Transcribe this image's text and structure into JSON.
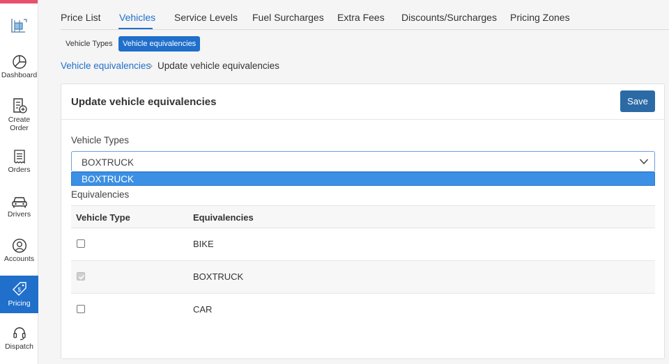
{
  "sidebar": {
    "items": [
      {
        "label": "Dashboard",
        "icon": "pie-chart-icon"
      },
      {
        "label": "Create Order",
        "icon": "new-document-icon"
      },
      {
        "label": "Orders",
        "icon": "receipt-icon"
      },
      {
        "label": "Drivers",
        "icon": "car-icon"
      },
      {
        "label": "Accounts",
        "icon": "user-circle-icon"
      },
      {
        "label": "Pricing",
        "icon": "price-tag-icon",
        "active": true
      },
      {
        "label": "Dispatch",
        "icon": "headset-icon"
      }
    ]
  },
  "tabs": [
    "Price List",
    "Vehicles",
    "Service Levels",
    "Fuel Surcharges",
    "Extra Fees",
    "Discounts/Surcharges",
    "Pricing Zones"
  ],
  "active_tab": "Vehicles",
  "subtabs": [
    "Vehicle Types",
    "Vehicle equivalencies"
  ],
  "active_subtab": "Vehicle equivalencies",
  "breadcrumb": {
    "parent": "Vehicle equivalencies",
    "separator": ">",
    "current": "Update vehicle equivalencies"
  },
  "card": {
    "title": "Update vehicle equivalencies",
    "save_label": "Save",
    "vehicle_types_label": "Vehicle Types",
    "selected_vehicle_type": "BOXTRUCK",
    "dropdown_options": [
      "BOXTRUCK"
    ],
    "equivalencies_label": "Equivalencies",
    "table": {
      "headers": [
        "Vehicle Type",
        "Equivalencies"
      ],
      "rows": [
        {
          "name": "BIKE",
          "checked": false,
          "disabled": false
        },
        {
          "name": "BOXTRUCK",
          "checked": true,
          "disabled": true
        },
        {
          "name": "CAR",
          "checked": false,
          "disabled": false
        }
      ]
    }
  },
  "colors": {
    "accent": "#1f6fcb",
    "save_button": "#2c6aa6",
    "brand_bar": "#e8506e",
    "dropdown_highlight": "#3b8fe4"
  }
}
